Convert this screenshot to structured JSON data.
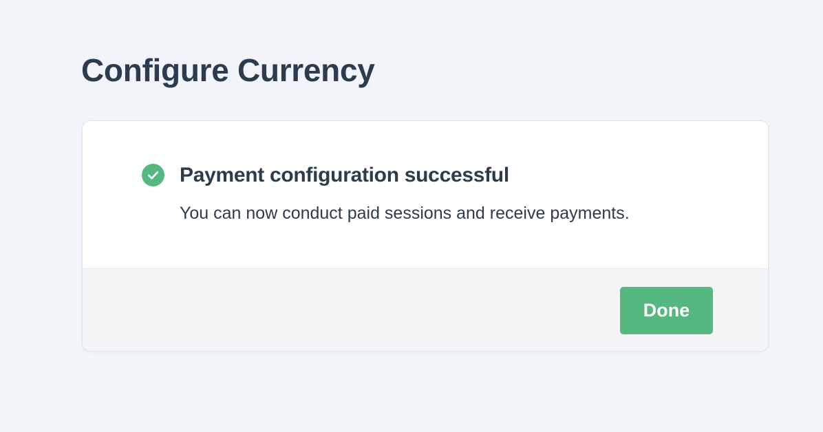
{
  "page": {
    "title": "Configure Currency"
  },
  "card": {
    "status_icon": "check-circle-icon",
    "success_title": "Payment configuration successful",
    "success_message": "You can now conduct paid sessions and receive payments.",
    "done_label": "Done"
  },
  "colors": {
    "background": "#f1f4f8",
    "text": "#2d3b4e",
    "card": "#ffffff",
    "footer": "#f3f5f7",
    "success": "#55b880"
  }
}
